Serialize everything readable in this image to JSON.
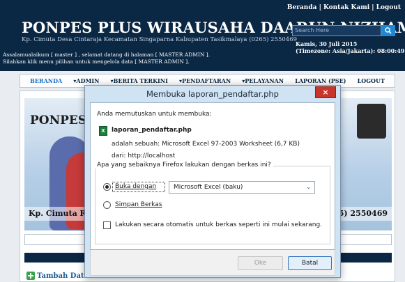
{
  "site": {
    "top_links": "Beranda | Kontak Kami | Logout",
    "title": "PONPES PLUS WIRAUSAHA DAARUN NIZHAM",
    "subtitle": "Kp. Cimuta Desa Cintaraja Kecamatan Singaparna Kabupaten Tasikmalaya (0265) 2550469",
    "search_placeholder": "Search Here",
    "date": "Kamis, 30 Juli 2015",
    "timezone": "(Timezone: Asia/Jakarta): 08:00:49",
    "welcome_line1": "Assalamualaikum [ master ] , selamat datang di halaman [ MASTER ADMIN ].",
    "welcome_line2": "Silahkan klik menu pilihan untuk mengelola data [ MASTER ADMIN ]."
  },
  "nav": [
    {
      "label": "BERANDA"
    },
    {
      "label": "▾ADMIN"
    },
    {
      "label": "▾BERITA TERKINI"
    },
    {
      "label": "▾PENDAFTARAN"
    },
    {
      "label": "▾PELAYANAN"
    },
    {
      "label": "LAPORAN (PSE)"
    },
    {
      "label": "LOGOUT"
    }
  ],
  "content": {
    "banner_title": "PONPES",
    "banner_foot_left": "Kp. Cimuta R",
    "banner_foot_right": "65) 2550469",
    "add_data": "Tambah Data"
  },
  "dialog": {
    "title": "Membuka laporan_pendaftar.php",
    "intro": "Anda memutuskan untuk membuka:",
    "file_name": "laporan_pendaftar.php",
    "file_type_line": "adalah sebuah:  Microsoft Excel 97-2003 Worksheet (6,7 KB)",
    "source_line": "dari:  http://localhost",
    "question": "Apa yang sebaiknya Firefox lakukan dengan berkas ini?",
    "open_with_label": "Buka dengan",
    "open_with_value": "Microsoft Excel (baku)",
    "save_label": "Simpan Berkas",
    "auto_label": "Lakukan secara otomatis untuk berkas seperti ini mulai sekarang.",
    "ok_label": "Oke",
    "cancel_label": "Batal",
    "close_label": "×"
  },
  "colors": {
    "header_bg": "#0a2744",
    "dialog_frame": "#d0e3f3",
    "close_button": "#c7352b",
    "excel_icon": "#1e7b3c"
  },
  "icons": [
    "search-icon",
    "excel-file-icon",
    "close-icon",
    "chevron-down-icon",
    "add-icon"
  ]
}
